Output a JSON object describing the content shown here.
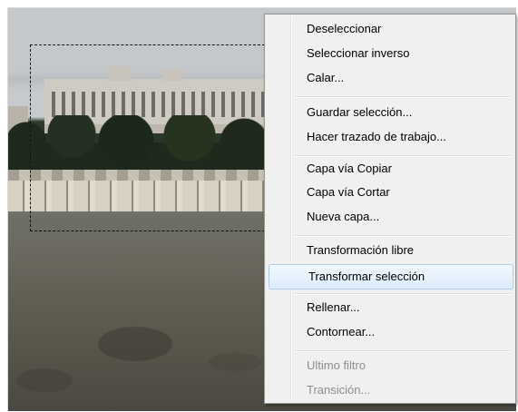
{
  "context_menu": {
    "groups": [
      {
        "items": [
          {
            "label": "Deseleccionar",
            "enabled": true
          },
          {
            "label": "Seleccionar inverso",
            "enabled": true
          },
          {
            "label": "Calar...",
            "enabled": true
          }
        ]
      },
      {
        "items": [
          {
            "label": "Guardar selección...",
            "enabled": true
          },
          {
            "label": "Hacer trazado de trabajo...",
            "enabled": true
          }
        ]
      },
      {
        "items": [
          {
            "label": "Capa vía Copiar",
            "enabled": true
          },
          {
            "label": "Capa vía Cortar",
            "enabled": true
          },
          {
            "label": "Nueva capa...",
            "enabled": true
          }
        ]
      },
      {
        "items": [
          {
            "label": "Transformación libre",
            "enabled": true
          },
          {
            "label": "Transformar selección",
            "enabled": true,
            "highlighted": true
          }
        ]
      },
      {
        "items": [
          {
            "label": "Rellenar...",
            "enabled": true
          },
          {
            "label": "Contornear...",
            "enabled": true
          }
        ]
      },
      {
        "items": [
          {
            "label": "Ultimo filtro",
            "enabled": false
          },
          {
            "label": "Transición...",
            "enabled": false
          }
        ]
      }
    ]
  },
  "colors": {
    "menu_background": "#f0f0f0",
    "highlight_border": "#a8d0f0",
    "disabled_text": "#8d8d8d"
  }
}
